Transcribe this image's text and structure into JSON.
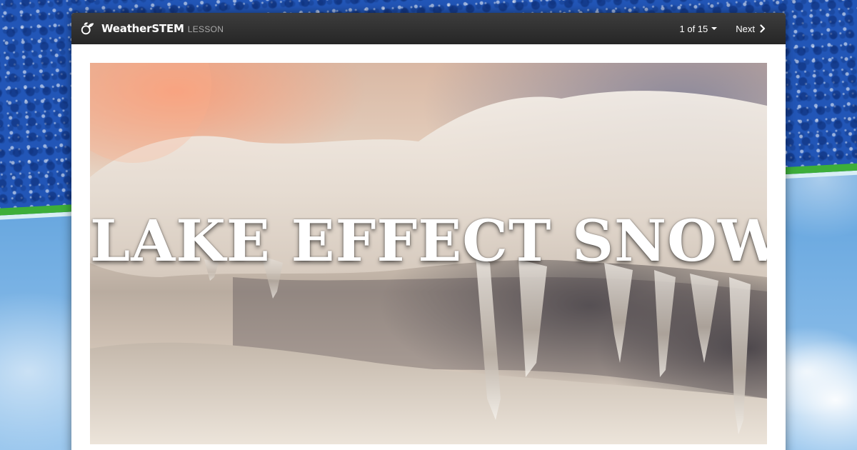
{
  "app": {
    "brand_name": "WeatherSTEM",
    "brand_suffix": "LESSON",
    "logo_icon": "weatherstem-logo-icon"
  },
  "navigation": {
    "page_indicator": "1 of 15",
    "page_dropdown_icon": "caret-down-icon",
    "next_label": "Next",
    "next_icon": "chevron-right-icon"
  },
  "slide": {
    "title": "LAKE EFFECT SNOW",
    "image": "icicles-on-snow-photo"
  },
  "colors": {
    "header_bar": "#2b2b2b",
    "card_background": "#ffffff",
    "accent_green": "#3dae3a",
    "background_blue": "#2256b7"
  }
}
